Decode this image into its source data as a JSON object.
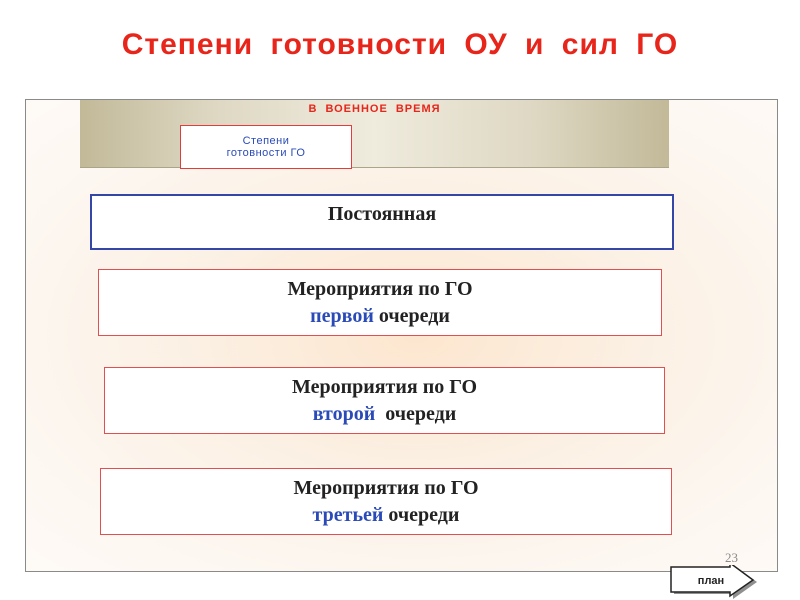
{
  "slide": {
    "title": "Степени  готовности  ОУ  и  сил  ГО",
    "band_label": "В  ВОЕННОЕ  ВРЕМЯ",
    "small_box": {
      "line1": "Степени",
      "line2": "готовности  ГО"
    },
    "constant_box": "Постоянная",
    "measures": [
      {
        "line1": "Мероприятия по ГО",
        "accent": "первой",
        "rest": " очереди"
      },
      {
        "line1": "Мероприятия по ГО",
        "accent": "второй",
        "rest": "  очереди"
      },
      {
        "line1": "Мероприятия по ГО",
        "accent": "третьей",
        "rest": " очереди"
      }
    ],
    "page_number": "23"
  },
  "nav": {
    "plan_label": "план"
  },
  "colors": {
    "title": "#e8251a",
    "accent_blue": "#2a4ab8",
    "constant_border": "#3447a6",
    "measure_border": "#e05050"
  }
}
